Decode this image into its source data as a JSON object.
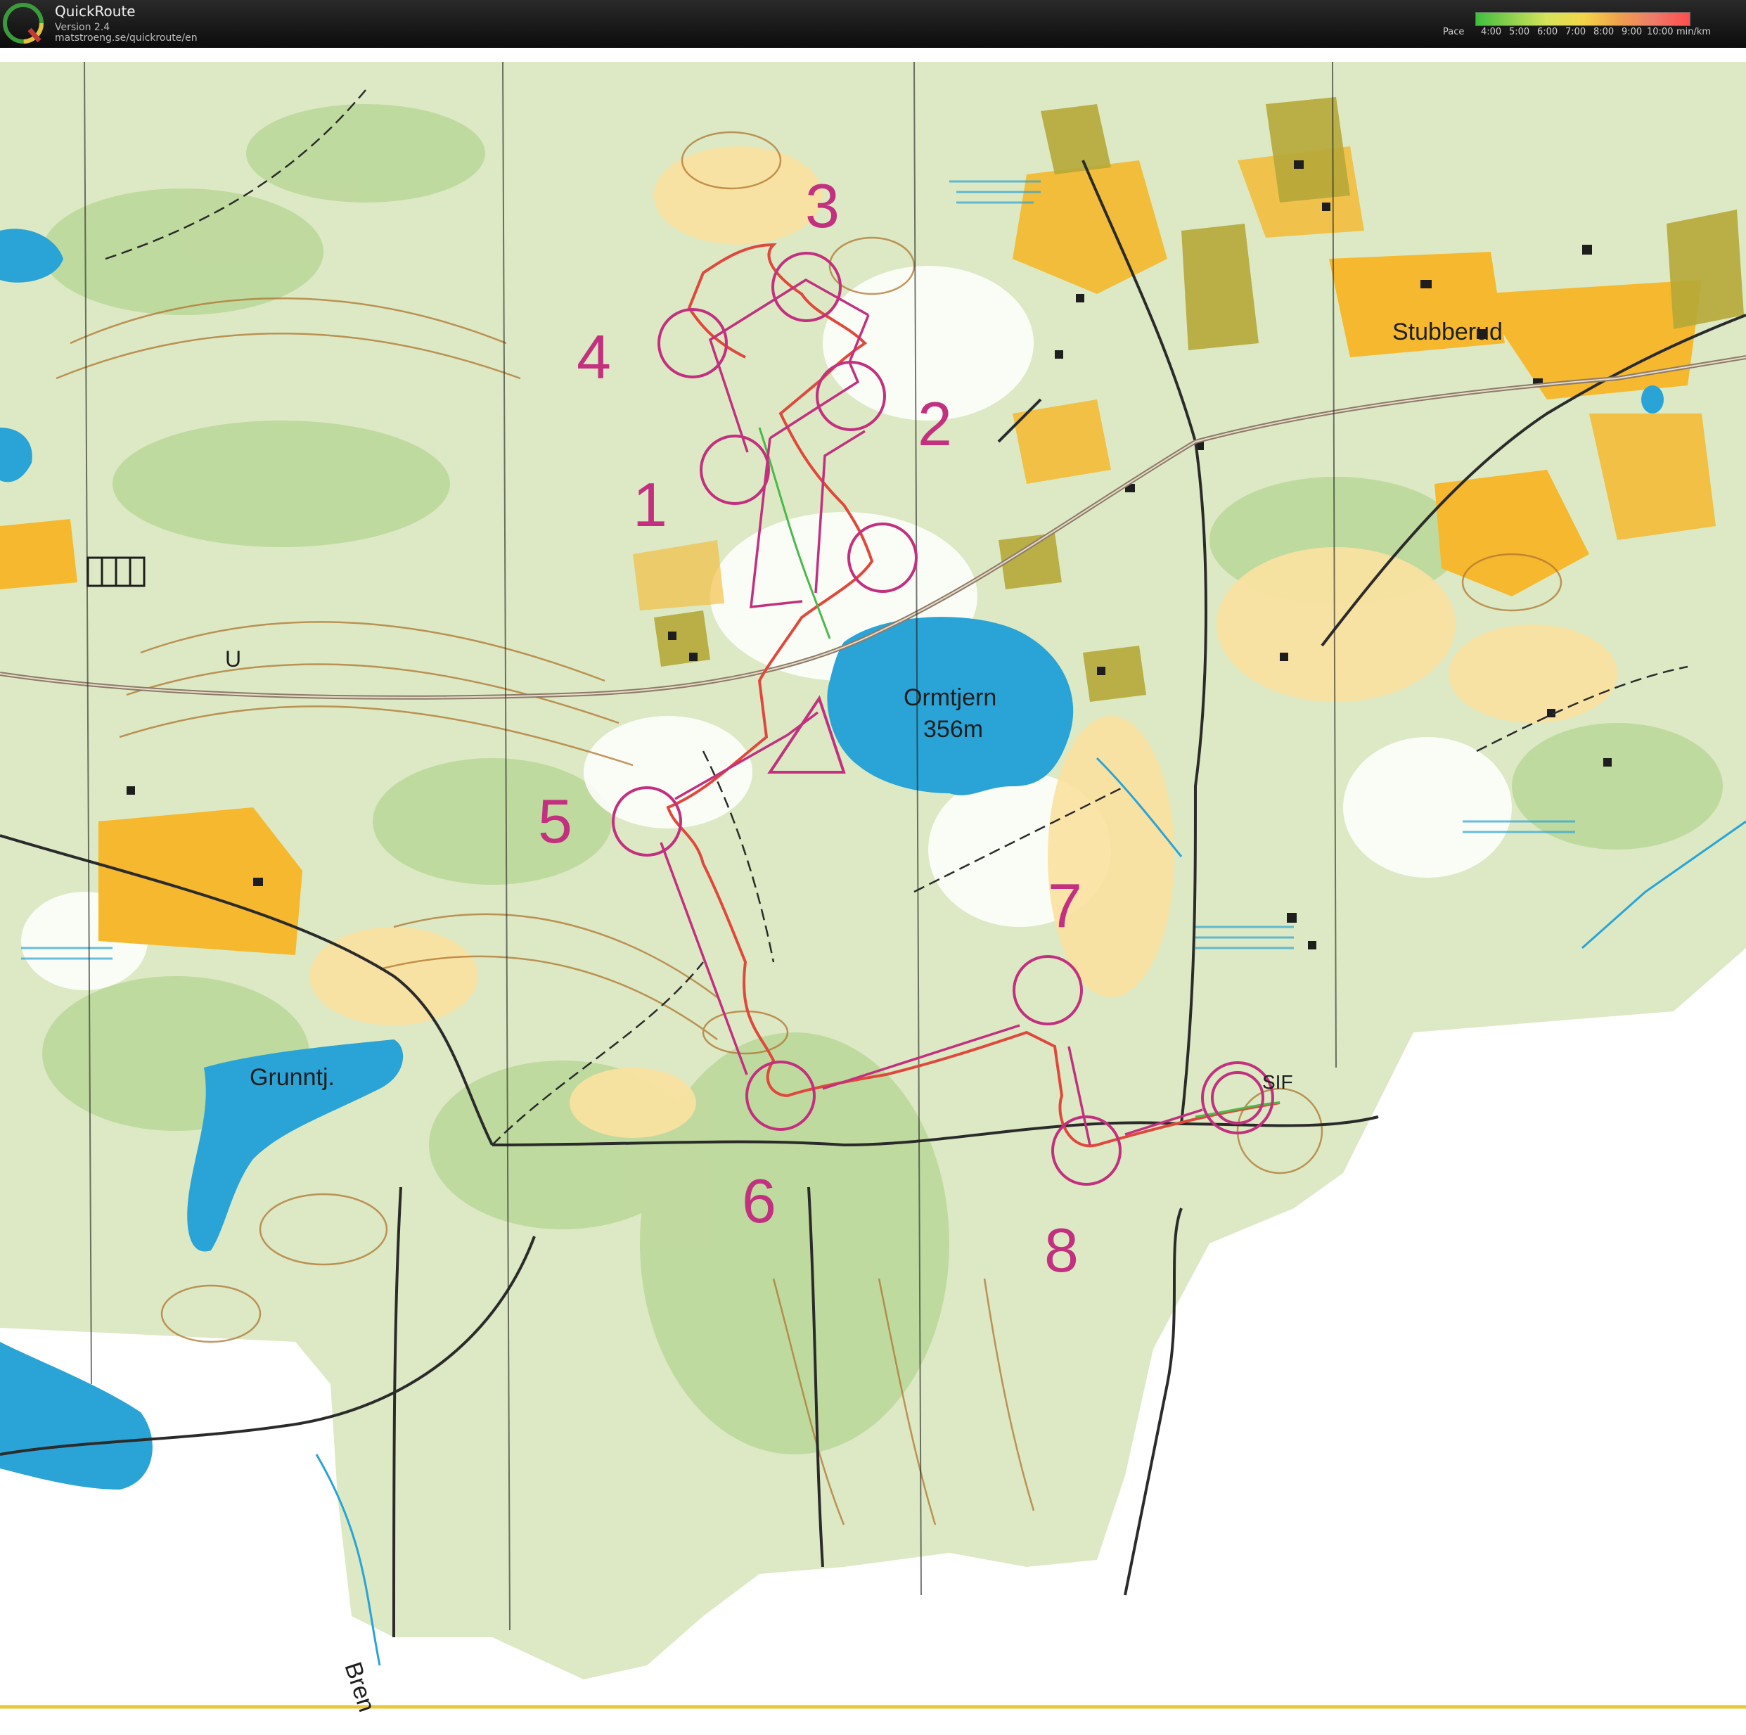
{
  "app": {
    "title": "QuickRoute",
    "version": "Version 2.4",
    "url": "matstroeng.se/quickroute/en",
    "logo_icon": "quickroute-q-logo-icon"
  },
  "pace_legend": {
    "label": "Pace",
    "ticks": [
      "4:00",
      "5:00",
      "6:00",
      "7:00",
      "8:00",
      "9:00",
      "10:00"
    ],
    "unit": "min/km",
    "colors": [
      "#3fbf3f",
      "#8fd14f",
      "#d6e35a",
      "#f2d64a",
      "#f0a24a",
      "#ee7a6a",
      "#ff4d4d"
    ]
  },
  "map": {
    "labels": {
      "stubberud": "Stubberud",
      "ormtjern": "Ormtjern",
      "ormtjern_height": "356m",
      "grunntj": "Grunntj.",
      "sif": "SIF",
      "bren": "Bren",
      "u": "U"
    },
    "control_numbers": [
      "1",
      "2",
      "3",
      "4",
      "5",
      "6",
      "7",
      "8"
    ],
    "colors": {
      "course": "#c2307f",
      "water": "#2aa3d6",
      "open_land": "#f5b82e",
      "forest": "#cfe3b2",
      "contour": "#b0742e",
      "road": "#2b2b2b"
    }
  }
}
